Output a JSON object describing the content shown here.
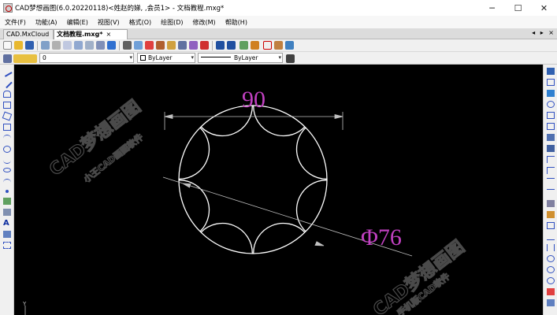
{
  "window": {
    "title": "CAD梦想画图(6.0.20220118)<姓赵的娣, ,会员1> - 文档教程.mxg*",
    "minimize": "─",
    "maximize": "☐",
    "close": "✕"
  },
  "menu": [
    "文件(F)",
    "功能(A)",
    "编辑(E)",
    "视图(V)",
    "格式(O)",
    "绘图(D)",
    "修改(M)",
    "帮助(H)"
  ],
  "tabs": {
    "inactive_label": "CAD.MxCloud",
    "active_label": "文档教程.mxg*",
    "close_glyph": "×",
    "nav": "◂ ▸ ×"
  },
  "toolbar2": {
    "layer_value": "0",
    "color_value": "ByLayer",
    "linetype_value": "ByLayer",
    "arrow": "▾"
  },
  "drawing": {
    "dimension_text": "90",
    "diameter_text": "Φ76",
    "watermark_main": "CAD梦想画图",
    "watermark_sub": "小王CAD画图软件",
    "watermark_sub2": "手机版CAD软件",
    "line_color": "#ffffff",
    "dimension_color": "#c040c0",
    "background": "#000000"
  }
}
